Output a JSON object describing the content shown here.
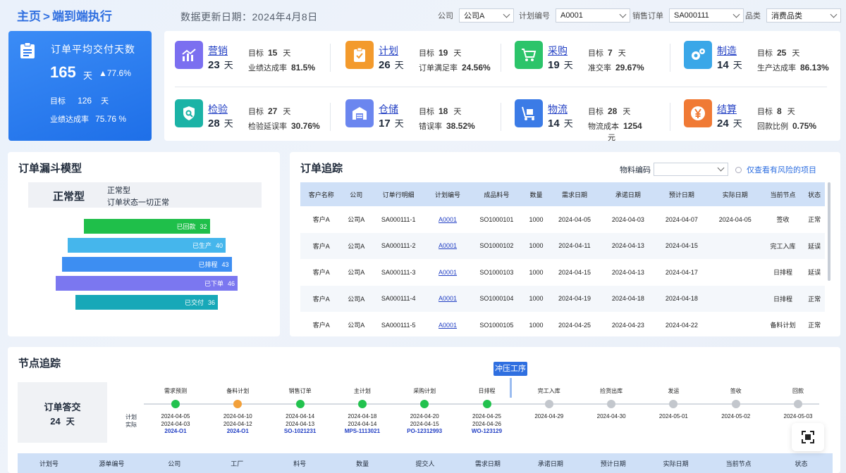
{
  "header": {
    "breadcrumb_home": "主页",
    "breadcrumb_sep": ">",
    "breadcrumb_current": "端到端执行",
    "update_label": "数据更新日期：2024年4月8日",
    "filters": [
      {
        "label": "公司",
        "value": "公司A"
      },
      {
        "label": "计划编号",
        "value": "A0001"
      },
      {
        "label": "销售订单",
        "value": "SA000111"
      },
      {
        "label": "品类",
        "value": "消费品类"
      }
    ]
  },
  "kpi": {
    "title": "订单平均交付天数",
    "value": "165",
    "unit": "天",
    "trend": "▲77.6%",
    "target_label": "目标",
    "target_value": "126",
    "target_unit": "天",
    "rate_label": "业绩达成率",
    "rate_value": "75.76 %"
  },
  "process": [
    {
      "name": "营销",
      "days": "23",
      "unit": "天",
      "m1_label": "目标",
      "m1_value": "15",
      "m1_unit": "天",
      "m2_label": "业绩达成率",
      "m2_value": "81.5%",
      "m2_unit": "",
      "color": "#7b6ff0",
      "icon": "chart-icon"
    },
    {
      "name": "计划",
      "days": "26",
      "unit": "天",
      "m1_label": "目标",
      "m1_value": "19",
      "m1_unit": "天",
      "m2_label": "订单满足率",
      "m2_value": "24.56%",
      "m2_unit": "",
      "color": "#f39a2c",
      "icon": "clipboard-check-icon"
    },
    {
      "name": "采购",
      "days": "19",
      "unit": "天",
      "m1_label": "目标",
      "m1_value": "7",
      "m1_unit": "天",
      "m2_label": "准交率",
      "m2_value": "29.67%",
      "m2_unit": "",
      "color": "#2cc46a",
      "icon": "cart-icon"
    },
    {
      "name": "制造",
      "days": "14",
      "unit": "天",
      "m1_label": "目标",
      "m1_value": "25",
      "m1_unit": "天",
      "m2_label": "生产达成率",
      "m2_value": "86.13%",
      "m2_unit": "",
      "color": "#3aa7e8",
      "icon": "gears-icon"
    },
    {
      "name": "检验",
      "days": "28",
      "unit": "天",
      "m1_label": "目标",
      "m1_value": "27",
      "m1_unit": "天",
      "m2_label": "检验延误率",
      "m2_value": "30.76%",
      "m2_unit": "",
      "color": "#1bb3a6",
      "icon": "shield-search-icon"
    },
    {
      "name": "仓储",
      "days": "17",
      "unit": "天",
      "m1_label": "目标",
      "m1_value": "18",
      "m1_unit": "天",
      "m2_label": "错误率",
      "m2_value": "38.52%",
      "m2_unit": "",
      "color": "#6b86ef",
      "icon": "warehouse-icon"
    },
    {
      "name": "物流",
      "days": "14",
      "unit": "天",
      "m1_label": "目标",
      "m1_value": "28",
      "m1_unit": "天",
      "m2_label": "物流成本",
      "m2_value": "1254",
      "m2_unit": "元",
      "color": "#3b7be6",
      "icon": "trolley-icon"
    },
    {
      "name": "结算",
      "days": "24",
      "unit": "天",
      "m1_label": "目标",
      "m1_value": "8",
      "m1_unit": "天",
      "m2_label": "回款比例",
      "m2_value": "0.75%",
      "m2_unit": "",
      "color": "#f07a35",
      "icon": "yen-icon"
    }
  ],
  "funnel": {
    "title": "订单漏斗模型",
    "status_type": "正常型",
    "status_line1": "正常型",
    "status_line2": "订单状态一切正常",
    "bars": [
      {
        "label": "已回款",
        "value": 32,
        "color": "#1fbf4a"
      },
      {
        "label": "已生产",
        "value": 40,
        "color": "#45b6ec"
      },
      {
        "label": "已排程",
        "value": 43,
        "color": "#3d8ef2"
      },
      {
        "label": "已下单",
        "value": 46,
        "color": "#7b77f0"
      },
      {
        "label": "已交付",
        "value": 36,
        "color": "#17a8b8"
      }
    ]
  },
  "orders": {
    "title": "订单追踪",
    "material_label": "物料编码",
    "risk_label": "仅查看有风险的项目",
    "columns": [
      "客户名称",
      "公司",
      "订单行明细",
      "计划编号",
      "成品料号",
      "数量",
      "需求日期",
      "承诺日期",
      "预计日期",
      "实际日期",
      "当前节点",
      "状态"
    ],
    "rows": [
      [
        "客户A",
        "公司A",
        "SA000111-1",
        "A0001",
        "SO1000101",
        "1000",
        "2024-04-05",
        "2024-04-03",
        "2024-04-07",
        "2024-04-05",
        "签收",
        "正常"
      ],
      [
        "客户A",
        "公司A",
        "SA000111-2",
        "A0001",
        "SO1000102",
        "1000",
        "2024-04-11",
        "2024-04-13",
        "2024-04-15",
        "",
        "完工入库",
        "延误"
      ],
      [
        "客户A",
        "公司A",
        "SA000111-3",
        "A0001",
        "SO1000103",
        "1000",
        "2024-04-15",
        "2024-04-13",
        "2024-04-17",
        "",
        "日排程",
        "延误"
      ],
      [
        "客户A",
        "公司A",
        "SA000111-4",
        "A0001",
        "SO1000104",
        "1000",
        "2024-04-19",
        "2024-04-18",
        "2024-04-18",
        "",
        "日排程",
        "正常"
      ],
      [
        "客户A",
        "公司A",
        "SA000111-5",
        "A0001",
        "SO1000105",
        "1000",
        "2024-04-25",
        "2024-04-23",
        "2024-04-22",
        "",
        "备料计划",
        "正常"
      ]
    ]
  },
  "node": {
    "title": "节点追踪",
    "box_title": "订单答交",
    "box_value": "24",
    "box_unit": "天",
    "plan_label": "计划",
    "actual_label": "实际",
    "marker": "冲压工序",
    "steps": [
      {
        "label": "需求预测",
        "d1": "2024-04-05",
        "d2": "2024-04-03",
        "code": "2024-O1",
        "status": "done"
      },
      {
        "label": "备料计划",
        "d1": "2024-04-10",
        "d2": "2024-04-12",
        "code": "2024-O1",
        "status": "warn"
      },
      {
        "label": "销售订单",
        "d1": "2024-04-14",
        "d2": "2024-04-13",
        "code": "SO-1021231",
        "status": "done"
      },
      {
        "label": "主计划",
        "d1": "2024-04-18",
        "d2": "2024-04-14",
        "code": "MPS-1113021",
        "status": "done"
      },
      {
        "label": "采购计划",
        "d1": "2024-04-20",
        "d2": "2024-04-15",
        "code": "PO-12312993",
        "status": "done"
      },
      {
        "label": "日排程",
        "d1": "2024-04-25",
        "d2": "2024-04-26",
        "code": "WO-123129",
        "status": "done"
      },
      {
        "label": "完工入库",
        "d1": "2024-04-29",
        "d2": "",
        "code": "",
        "status": "todo"
      },
      {
        "label": "捡货出库",
        "d1": "2024-04-30",
        "d2": "",
        "code": "",
        "status": "todo"
      },
      {
        "label": "发运",
        "d1": "2024-05-01",
        "d2": "",
        "code": "",
        "status": "todo"
      },
      {
        "label": "签收",
        "d1": "2024-05-02",
        "d2": "",
        "code": "",
        "status": "todo"
      },
      {
        "label": "回款",
        "d1": "2024-05-03",
        "d2": "",
        "code": "",
        "status": "todo"
      }
    ],
    "columns": [
      "计划号",
      "源单编号",
      "公司",
      "工厂",
      "料号",
      "数量",
      "提交人",
      "需求日期",
      "承诺日期",
      "预计日期",
      "实际日期",
      "当前节点",
      "状态"
    ]
  },
  "colors": {
    "done": "#22c24e",
    "warn": "#f2a03a",
    "todo": "#c3c7cd"
  }
}
